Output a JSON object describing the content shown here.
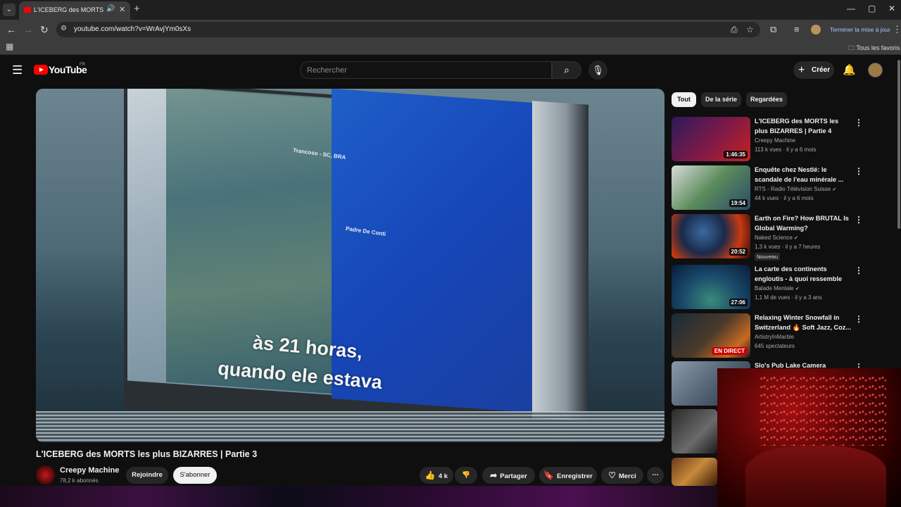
{
  "browser": {
    "tab_title": "L'ICEBERG des MORTS les p",
    "url": "youtube.com/watch?v=WrAvjYm0sXs",
    "update_label": "Terminer la mise à jour",
    "bookmarks_all": "Tous les favoris",
    "icons": [
      "tab-list-icon",
      "speaker-icon",
      "close-icon",
      "new-tab-icon",
      "minimize-icon",
      "maximize-icon",
      "window-close-icon",
      "back-icon",
      "forward-icon",
      "reload-icon",
      "site-info-icon",
      "install-icon",
      "star-icon",
      "extensions-icon",
      "reading-list-icon",
      "apps-icon",
      "folder-icon"
    ]
  },
  "youtube": {
    "logo_text": "YouTube",
    "country": "FR",
    "search_placeholder": "Rechercher",
    "create_label": "Créer"
  },
  "video": {
    "subtitle_line1": "às 21 horas,",
    "subtitle_line2": "quando ele estava",
    "map_label1": "Trancoso - SC, BRA",
    "map_label2": "Padre De Conti",
    "title": "L'ICEBERG des MORTS les plus BIZARRES | Partie 3",
    "channel": "Creepy Machine",
    "subscribers": "78,2 k abonnés",
    "join_label": "Rejoindre",
    "subscribe_label": "S'abonner",
    "likes": "4 k",
    "share_label": "Partager",
    "save_label": "Enregistrer",
    "thanks_label": "Merci"
  },
  "sidebar": {
    "chips": [
      "Tout",
      "De la série",
      "Regardées"
    ],
    "recommendations": [
      {
        "title": "L'ICEBERG des MORTS les plus BIZARRES | Partie 4",
        "channel": "Creepy Machine",
        "meta": "113 k vues · il y a 6 mois",
        "duration": "1:46:35",
        "thumb_color": "#7a1a4a"
      },
      {
        "title": "Enquête chez Nestlé: le scandale de l'eau minérale ...",
        "channel": "RTS - Radio Télévision Suisse",
        "meta": "44 k vues · il y a 6 mois",
        "duration": "19:54",
        "thumb_color": "#3a5a3a",
        "verified": true
      },
      {
        "title": "Earth on Fire? How BRUTAL Is Global Warming?",
        "channel": "Naked Science",
        "meta": "1,3 k vues · il y a 7 heures",
        "duration": "20:52",
        "badge": "Nouveau",
        "thumb_color": "#6a1a0a",
        "verified": true
      },
      {
        "title": "La carte des continents engloutis - à quoi ressemble la...",
        "channel": "Balade Mentale",
        "meta": "1,1 M de vues · il y a 3 ans",
        "duration": "27:06",
        "thumb_color": "#1a4a6a",
        "verified": true
      },
      {
        "title": "Relaxing Winter Snowfall in Switzerland 🔥 Soft Jazz, Coz...",
        "channel": "ArtistryInMarble",
        "meta": "645 spectateurs",
        "live_label": "EN DIRECT",
        "thumb_color": "#2a3a4a"
      },
      {
        "title": "Slo's Pub Lake Camera",
        "channel": "",
        "meta": "",
        "thumb_color": "#5a6a7a"
      }
    ]
  }
}
